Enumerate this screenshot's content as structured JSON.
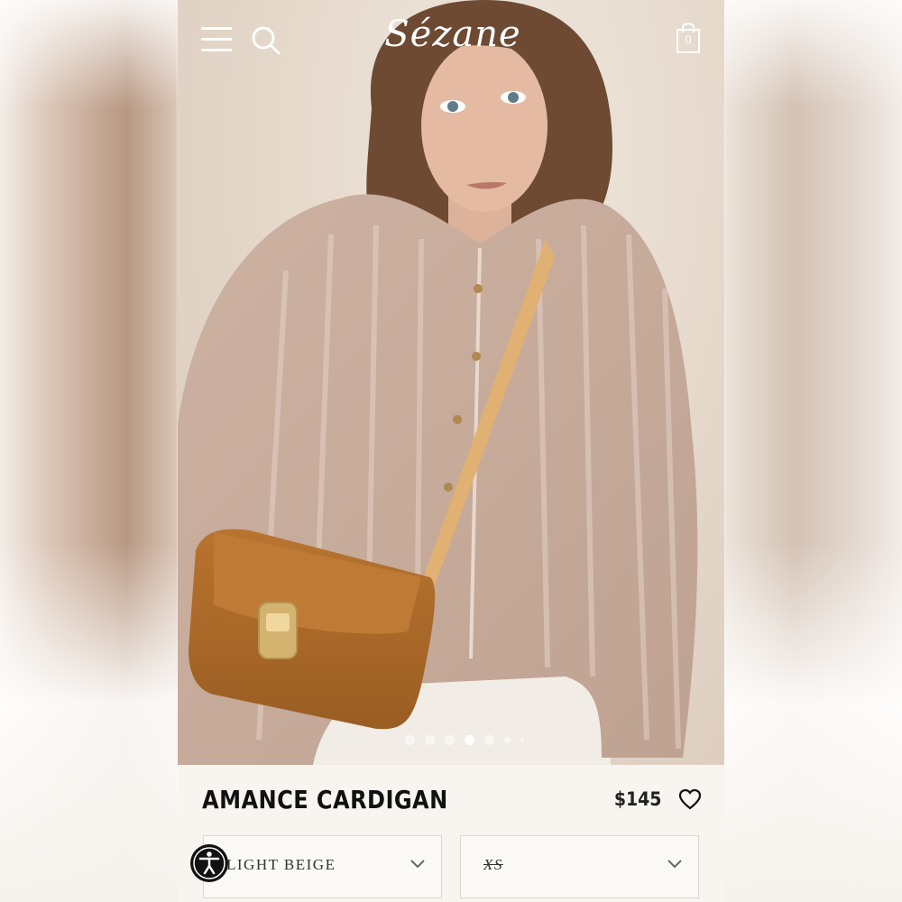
{
  "header": {
    "logo": "Sézane",
    "bag_count": "0"
  },
  "icons": {
    "menu": "menu-icon",
    "search": "search-icon",
    "bag": "shopping-bag-icon",
    "heart": "heart-icon",
    "accessibility": "accessibility-icon",
    "chevron": "chevron-down-icon"
  },
  "carousel": {
    "image_count": 7,
    "active_index": 3
  },
  "product": {
    "name": "AMANCE CARDIGAN",
    "price": "$145"
  },
  "selectors": {
    "color_value": "LIGHT BEIGE",
    "size_value": "XS"
  }
}
